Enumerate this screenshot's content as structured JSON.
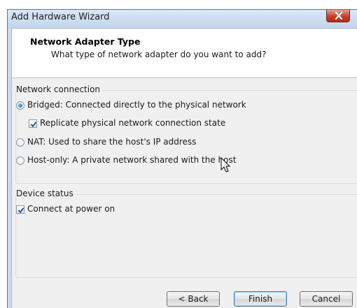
{
  "window": {
    "title": "Add Hardware Wizard"
  },
  "header": {
    "title": "Network Adapter Type",
    "subtitle": "What type of network adapter do you want to add?"
  },
  "network_connection": {
    "group_label": "Network connection",
    "bridged_label": "Bridged: Connected directly to the physical network",
    "bridged_selected": true,
    "replicate_label": "Replicate physical network connection state",
    "replicate_checked": true,
    "nat_label": "NAT: Used to share the host's IP address",
    "nat_selected": false,
    "hostonly_label": "Host-only: A private network shared with the host",
    "hostonly_selected": false
  },
  "device_status": {
    "group_label": "Device status",
    "connect_label": "Connect at power on",
    "connect_checked": true
  },
  "buttons": {
    "back": "< Back",
    "finish": "Finish",
    "cancel": "Cancel"
  },
  "colors": {
    "title_bar": "#c3d5ea",
    "close_button": "#c6402a",
    "radio_dot": "#1d5fa6",
    "default_button_border": "#3c7fb1"
  }
}
